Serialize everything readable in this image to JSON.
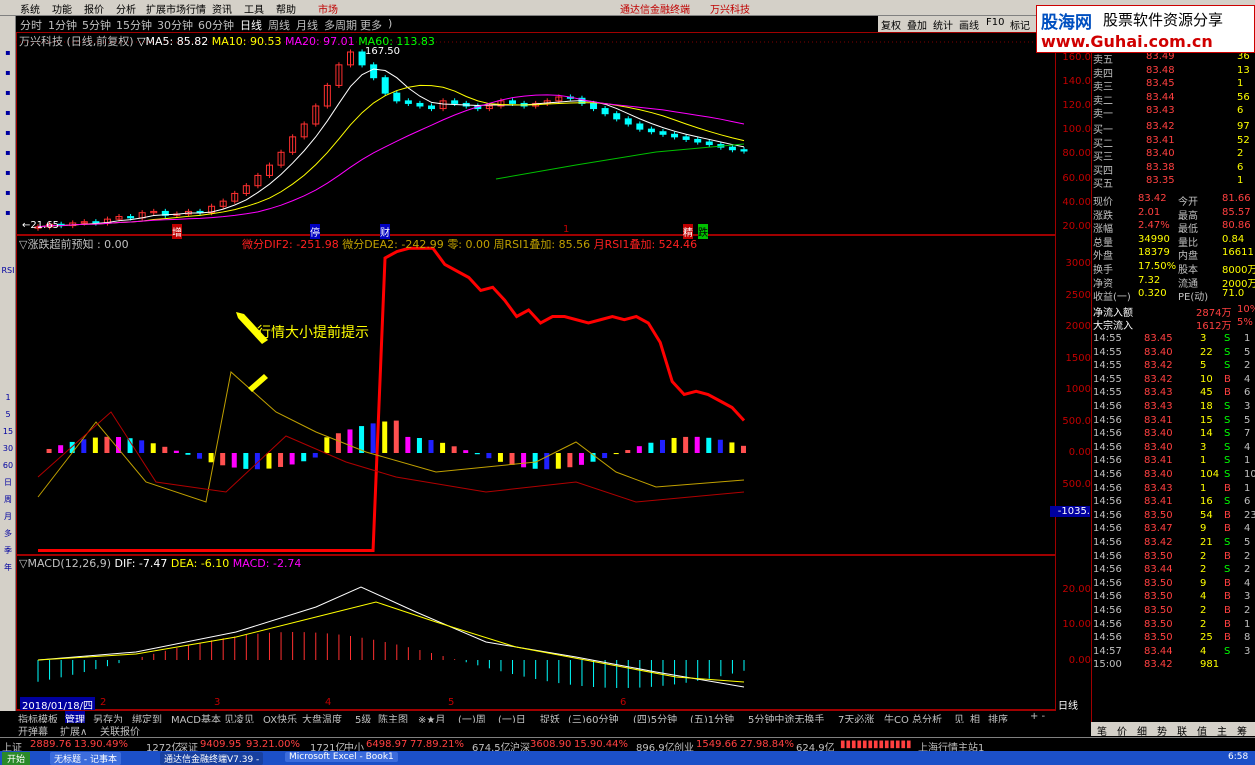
{
  "menu": [
    "系统",
    "功能",
    "报价",
    "分析",
    "扩展市场行情",
    "资讯",
    "工具",
    "帮助"
  ],
  "menu_market": "市场",
  "title_center": "通达信金融终端",
  "title_stock": "万兴科技",
  "periods": [
    "分时",
    "1分钟",
    "5分钟",
    "15分钟",
    "30分钟",
    "60分钟",
    "日线",
    "周线",
    "月线",
    "多周期",
    "更多",
    ")"
  ],
  "selected_period": "日线",
  "toolbar": [
    "复权",
    "叠加",
    "统计",
    "画线",
    "F10",
    "标记"
  ],
  "brand": {
    "name": "股海网",
    "tag": "股票软件资源分享",
    "url": "www.Guhai.com.cn"
  },
  "left_icons": [
    "RSI",
    "1",
    "5",
    "15",
    "30",
    "60",
    "日",
    "周",
    "月",
    "多",
    "季",
    "年"
  ],
  "kline": {
    "title": "万兴科技 (日线,前复权)",
    "ma5_label": "▽MA5: 85.82",
    "ma10_label": "MA10: 90.53",
    "ma20_label": "MA20: 97.01",
    "ma60_label": "MA60: 113.83",
    "high_label": "167.50",
    "low_label": "←21.65",
    "axis": [
      "160.0",
      "140.0",
      "120.0",
      "100.0",
      "80.00",
      "60.00",
      "40.00",
      "20.00"
    ],
    "event_tags": [
      "增",
      "停",
      "财",
      "1",
      "精",
      "跌"
    ],
    "closes": [
      24,
      26,
      25,
      27,
      28,
      27,
      30,
      32,
      31,
      35,
      36,
      33,
      34,
      36,
      35,
      40,
      44,
      50,
      56,
      64,
      72,
      82,
      94,
      104,
      118,
      134,
      150,
      160,
      150,
      140,
      128,
      122,
      120,
      118,
      116,
      122,
      120,
      118,
      116,
      118,
      122,
      120,
      118,
      120,
      122,
      125,
      124,
      120,
      116,
      112,
      108,
      104,
      100,
      98,
      96,
      94,
      92,
      90,
      88,
      86,
      84,
      83
    ]
  },
  "indicator": {
    "title": "▽涨跌超前预知 : 0.00",
    "dif2": "微分DIF2: -251.98",
    "dea2": "微分DEA2: -242.99",
    "zero": "零: 0.00",
    "rsi1": "周RSI1叠加: 85.56",
    "rsi2": "月RSI1叠加: 524.46",
    "axis": [
      "3000",
      "2500",
      "2000",
      "1500",
      "1000",
      "500.0",
      "0.00",
      "500.0"
    ],
    "neg_value": "-1035.",
    "annotation": "行情大小提前提示",
    "red_line": [
      -1500,
      -1500,
      -1500,
      -1500,
      -1500,
      -1500,
      -1500,
      -1500,
      -1500,
      -1500,
      -1500,
      -1400,
      -1500,
      -1500,
      -1500,
      -1500,
      -1500,
      -1500,
      -1500,
      -1500,
      -1500,
      -1500,
      -1500,
      -1500,
      -1500,
      -1500,
      -1500,
      -1500,
      -1500,
      3000,
      3100,
      3150,
      3150,
      3150,
      2900,
      2800,
      2700,
      2500,
      2550,
      2350,
      2100,
      2200,
      2000,
      2100,
      2100,
      2050,
      2000,
      2050,
      2100,
      2050,
      2100,
      2000,
      1700,
      1100,
      900,
      950,
      900,
      800,
      700,
      500
    ]
  },
  "macd": {
    "title": "▽MACD(12,26,9)",
    "dif": "DIF: -7.47",
    "dea": "DEA: -6.10",
    "macd": "MACD: -2.74",
    "axis": [
      "20.00",
      "10.00",
      "0.00"
    ],
    "date": "2018/01/18/四",
    "day": "日线",
    "months": [
      "2",
      "3",
      "4",
      "5",
      "6"
    ]
  },
  "bottom_tabs": [
    "指标模板",
    "管理",
    "另存为",
    "绑定到",
    "MACD基本",
    "见凌见",
    "OX快乐",
    "大盘温度",
    "5级",
    "陈主图",
    "※★月",
    "(一)周",
    "(一)日",
    "捉妖",
    "(三)60分钟",
    "(四)5分钟",
    "(五)1分钟",
    "5分钟中途无换手",
    "7天必涨",
    "牛CO",
    "总分析",
    "见",
    "相",
    "排序"
  ],
  "sub_tabs": [
    "开弹幕",
    "扩展∧",
    "关联报价"
  ],
  "quote": {
    "asks": [
      [
        "卖五",
        "83.49",
        "36"
      ],
      [
        "卖四",
        "83.48",
        "13"
      ],
      [
        "卖三",
        "83.45",
        "1"
      ],
      [
        "卖二",
        "83.44",
        "56"
      ],
      [
        "卖一",
        "83.43",
        "6"
      ]
    ],
    "bids": [
      [
        "买一",
        "83.42",
        "97"
      ],
      [
        "买二",
        "83.41",
        "52"
      ],
      [
        "买三",
        "83.40",
        "2"
      ],
      [
        "买四",
        "83.38",
        "6"
      ],
      [
        "买五",
        "83.35",
        "1"
      ]
    ],
    "stats": [
      [
        "现价",
        "83.42",
        "今开",
        "81.66"
      ],
      [
        "涨跌",
        "2.01",
        "最高",
        "85.57"
      ],
      [
        "涨幅",
        "2.47%",
        "最低",
        "80.86"
      ],
      [
        "总量",
        "34990",
        "量比",
        "0.84"
      ],
      [
        "外盘",
        "18379",
        "内盘",
        "16611"
      ],
      [
        "换手",
        "17.50%",
        "股本",
        "8000万"
      ],
      [
        "净资",
        "7.32",
        "流通",
        "2000万"
      ],
      [
        "收益(一)",
        "0.320",
        "PE(动)",
        "71.0"
      ]
    ],
    "flows": [
      [
        "净流入额",
        "2874万",
        "10%"
      ],
      [
        "大宗流入",
        "1612万",
        "5%"
      ]
    ],
    "ticks": [
      [
        "14:55",
        "83.45",
        "3",
        "S",
        "1"
      ],
      [
        "14:55",
        "83.40",
        "22",
        "S",
        "5"
      ],
      [
        "14:55",
        "83.42",
        "5",
        "S",
        "2"
      ],
      [
        "14:55",
        "83.42",
        "10",
        "B",
        "4"
      ],
      [
        "14:55",
        "83.43",
        "45",
        "B",
        "6"
      ],
      [
        "14:56",
        "83.43",
        "18",
        "S",
        "3"
      ],
      [
        "14:56",
        "83.41",
        "15",
        "S",
        "5"
      ],
      [
        "14:56",
        "83.40",
        "14",
        "S",
        "7"
      ],
      [
        "14:56",
        "83.40",
        "3",
        "S",
        "4"
      ],
      [
        "14:56",
        "83.41",
        "1",
        "S",
        "1"
      ],
      [
        "14:56",
        "83.40",
        "104",
        "S",
        "10"
      ],
      [
        "14:56",
        "83.43",
        "1",
        "B",
        "1"
      ],
      [
        "14:56",
        "83.41",
        "16",
        "S",
        "6"
      ],
      [
        "14:56",
        "83.50",
        "54",
        "B",
        "23"
      ],
      [
        "14:56",
        "83.47",
        "9",
        "B",
        "4"
      ],
      [
        "14:56",
        "83.42",
        "21",
        "S",
        "5"
      ],
      [
        "14:56",
        "83.50",
        "2",
        "B",
        "2"
      ],
      [
        "14:56",
        "83.44",
        "2",
        "S",
        "2"
      ],
      [
        "14:56",
        "83.50",
        "9",
        "B",
        "4"
      ],
      [
        "14:56",
        "83.50",
        "4",
        "B",
        "3"
      ],
      [
        "14:56",
        "83.50",
        "2",
        "B",
        "2"
      ],
      [
        "14:56",
        "83.50",
        "2",
        "B",
        "1"
      ],
      [
        "14:56",
        "83.50",
        "25",
        "B",
        "8"
      ],
      [
        "14:57",
        "83.44",
        "4",
        "S",
        "3"
      ],
      [
        "15:00",
        "83.42",
        "981",
        "",
        ""
      ]
    ]
  },
  "side_tabs": [
    "笔",
    "价",
    "细",
    "势",
    "联",
    "值",
    "主",
    "筹"
  ],
  "status": {
    "sh": "上证",
    "sh_val": "2889.76",
    "sh_chg": "13.90.49%",
    "sh_amt": "1272亿",
    "sz": "深证",
    "sz_val": "9409.95",
    "sz_chg": "93.21.00%",
    "sz_amt": "1721亿",
    "sm": "中小",
    "sm_val": "6498.97",
    "sm_chg": "77.89.21%",
    "sm_amt": "674.5亿",
    "hs": "沪深",
    "hs_val": "3608.90",
    "hs_chg": "15.90.44%",
    "hs_amt": "896.9亿",
    "cy": "创业",
    "cy_val": "1549.66",
    "cy_chg": "27.98.84%",
    "cy_amt": "624.9亿",
    "server": "上海行情主站1"
  },
  "taskbar": {
    "start": "开始",
    "items": [
      "无标题 - 记事本",
      "通达信金融终端V7.39 -",
      "Microsoft Excel - Book1"
    ],
    "time": "6:58"
  }
}
